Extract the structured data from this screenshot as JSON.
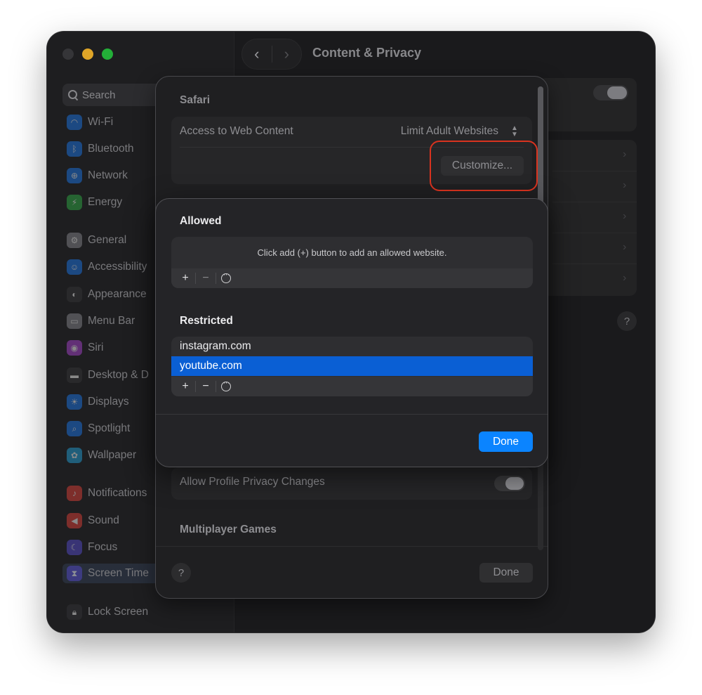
{
  "window": {
    "title": "Content & Privacy",
    "nav_back": "‹",
    "nav_forward": "›"
  },
  "sidebar": {
    "search_placeholder": "Search",
    "items": [
      {
        "label": "Wi-Fi",
        "color": "#1f7cf0",
        "icon": "wifi-icon"
      },
      {
        "label": "Bluetooth",
        "color": "#1f7cf0",
        "icon": "bluetooth-icon"
      },
      {
        "label": "Network",
        "color": "#1f7cf0",
        "icon": "globe-icon"
      },
      {
        "label": "Energy",
        "color": "#35b44a",
        "icon": "bolt-icon"
      },
      {
        "label": "General",
        "color": "#8e8e93",
        "icon": "gear-icon"
      },
      {
        "label": "Accessibility",
        "color": "#1f7cf0",
        "icon": "accessibility-icon"
      },
      {
        "label": "Appearance",
        "color": "#3a3a3c",
        "icon": "appearance-icon"
      },
      {
        "label": "Menu Bar",
        "color": "#8e8e93",
        "icon": "menubar-icon"
      },
      {
        "label": "Siri",
        "color": "#b048d8",
        "icon": "siri-icon"
      },
      {
        "label": "Desktop & D",
        "color": "#3a3a3c",
        "icon": "desktop-icon"
      },
      {
        "label": "Displays",
        "color": "#1f7cf0",
        "icon": "sun-icon"
      },
      {
        "label": "Spotlight",
        "color": "#1f7cf0",
        "icon": "search-icon"
      },
      {
        "label": "Wallpaper",
        "color": "#28a8e0",
        "icon": "flower-icon"
      },
      {
        "label": "Notifications",
        "color": "#e8453c",
        "icon": "bell-icon"
      },
      {
        "label": "Sound",
        "color": "#e8453c",
        "icon": "speaker-icon"
      },
      {
        "label": "Focus",
        "color": "#5a52d6",
        "icon": "moon-icon"
      },
      {
        "label": "Screen Time",
        "color": "#5a52d6",
        "icon": "hourglass-icon"
      },
      {
        "label": "Lock Screen",
        "color": "#3a3a3c",
        "icon": "lock-icon"
      }
    ]
  },
  "sheet_back": {
    "section_safari": "Safari",
    "access_label": "Access to Web Content",
    "access_value": "Limit Adult Websites",
    "customize_label": "Customize...",
    "profile_privacy_label": "Allow Profile Privacy Changes",
    "multiplayer_heading": "Multiplayer Games",
    "help_label": "?",
    "done_label": "Done"
  },
  "sheet_front": {
    "allowed_heading": "Allowed",
    "allowed_empty_text": "Click add (+) button to add an allowed website.",
    "restricted_heading": "Restricted",
    "restricted_items": [
      "instagram.com",
      "youtube.com"
    ],
    "selected_index": 1,
    "add_label": "+",
    "remove_label": "−",
    "done_label": "Done"
  },
  "background": {
    "help_label": "?"
  },
  "colors": {
    "accent": "#0b84ff",
    "selection": "#0a5fd4",
    "highlight_ring": "#d9331f"
  }
}
